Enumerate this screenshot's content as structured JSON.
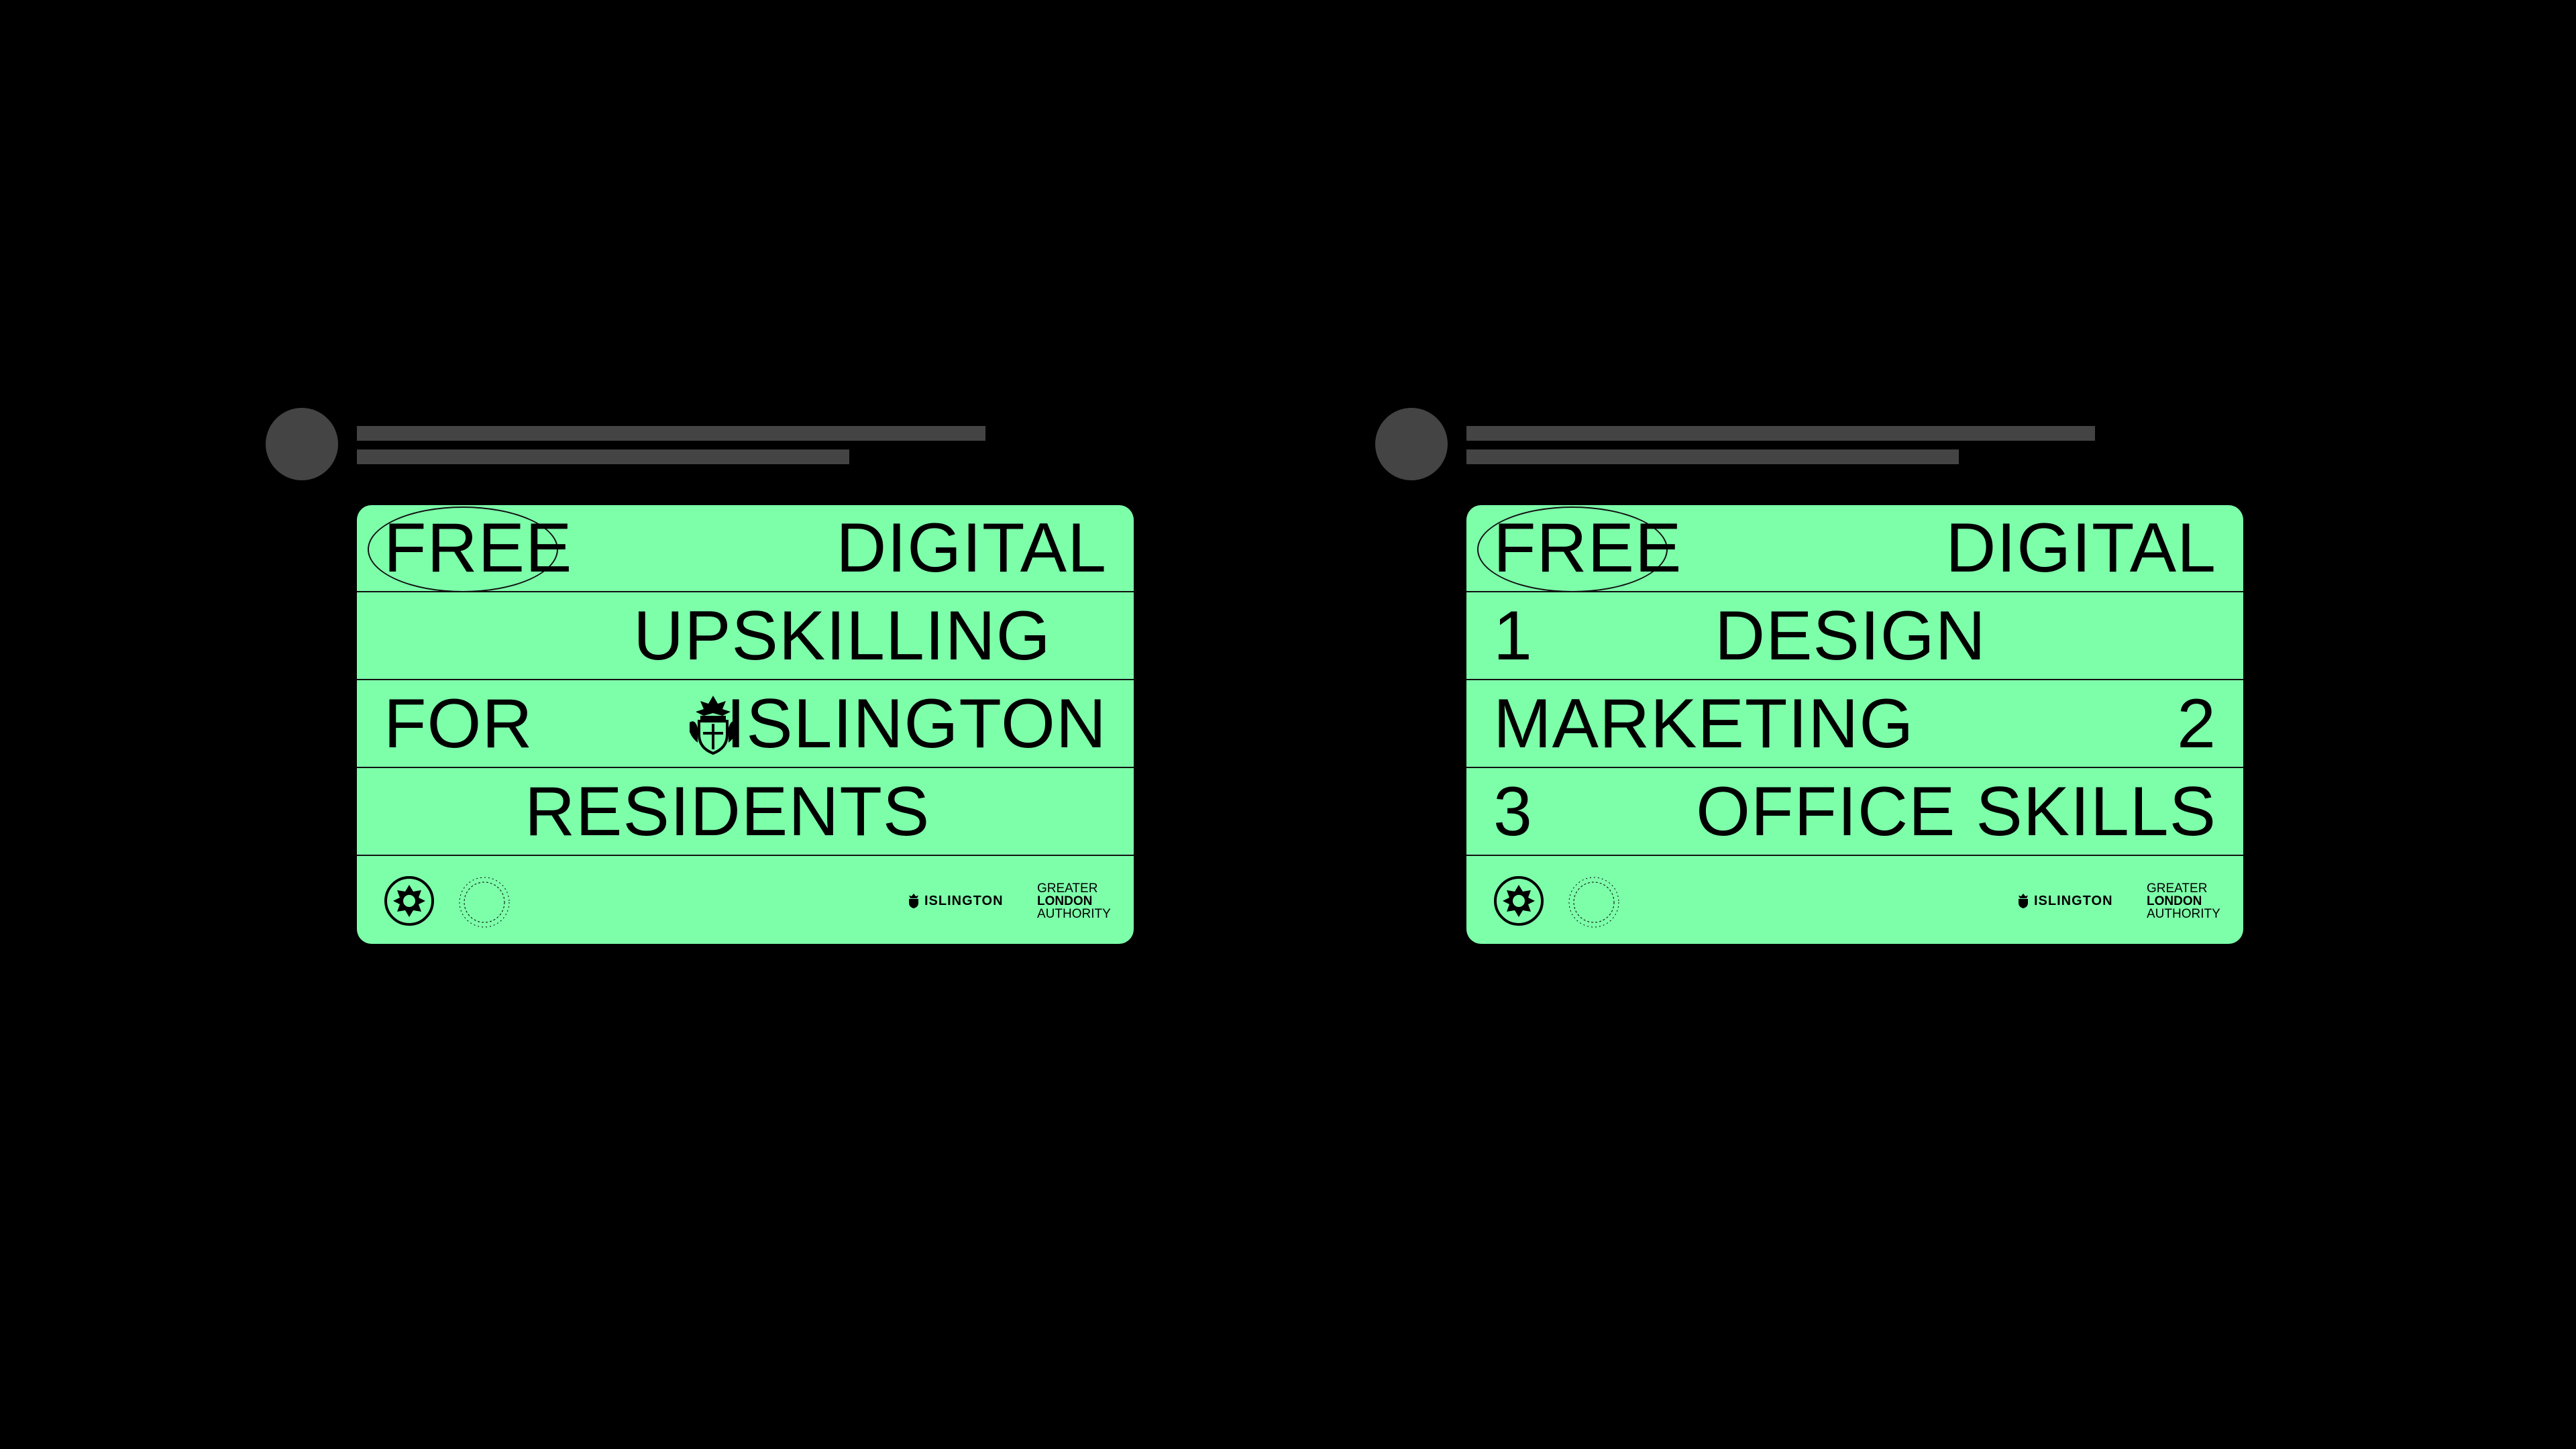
{
  "posts": [
    {
      "rows": [
        "FREE",
        "DIGITAL",
        "UPSKILLING",
        "FOR",
        "ISLINGTON",
        "RESIDENTS"
      ],
      "footer": {
        "ring_text": "• GOOD PRAXIS • GOOD PRAXIS",
        "islington": "ISLINGTON",
        "gla_line1": "GREATER",
        "gla_line2": "LONDON",
        "gla_line3": "AUTHORITY"
      }
    },
    {
      "rows": [
        "FREE",
        "DIGITAL",
        "1",
        "DESIGN",
        "MARKETING",
        "2",
        "3",
        "OFFICE SKILLS"
      ],
      "footer": {
        "ring_text": "• GOOD PRAXIS • GOOD PRAXIS",
        "islington": "ISLINGTON",
        "gla_line1": "GREATER",
        "gla_line2": "LONDON",
        "gla_line3": "AUTHORITY"
      }
    }
  ],
  "colors": {
    "background": "#000000",
    "card": "#7dffaa",
    "placeholder": "#444444",
    "ink": "#000000"
  }
}
